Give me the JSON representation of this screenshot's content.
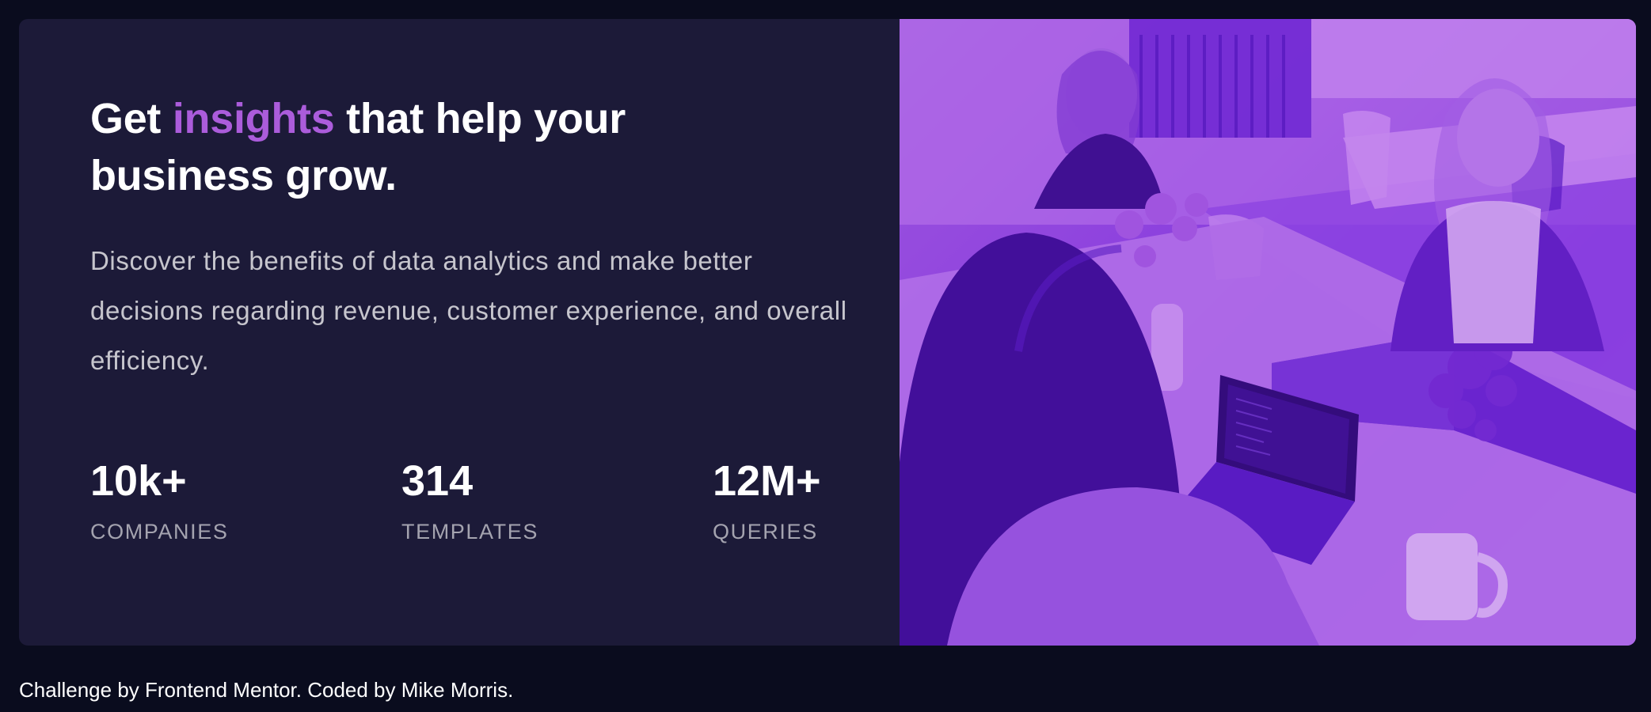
{
  "hero": {
    "headline_before": "Get ",
    "headline_accent": "insights",
    "headline_after": " that help your business grow.",
    "description": "Discover the benefits of data analytics and make better decisions regarding revenue, customer experience, and overall efficiency.",
    "accent_color": "#ab5cdb"
  },
  "stats": [
    {
      "value": "10k+",
      "label": "COMPANIES"
    },
    {
      "value": "314",
      "label": "TEMPLATES"
    },
    {
      "value": "12M+",
      "label": "QUERIES"
    }
  ],
  "image": {
    "subject": "office-team-photo",
    "tint_color": "#8b3fe6"
  },
  "footer": {
    "attribution": "Challenge by Frontend Mentor. Coded by Mike Morris."
  }
}
